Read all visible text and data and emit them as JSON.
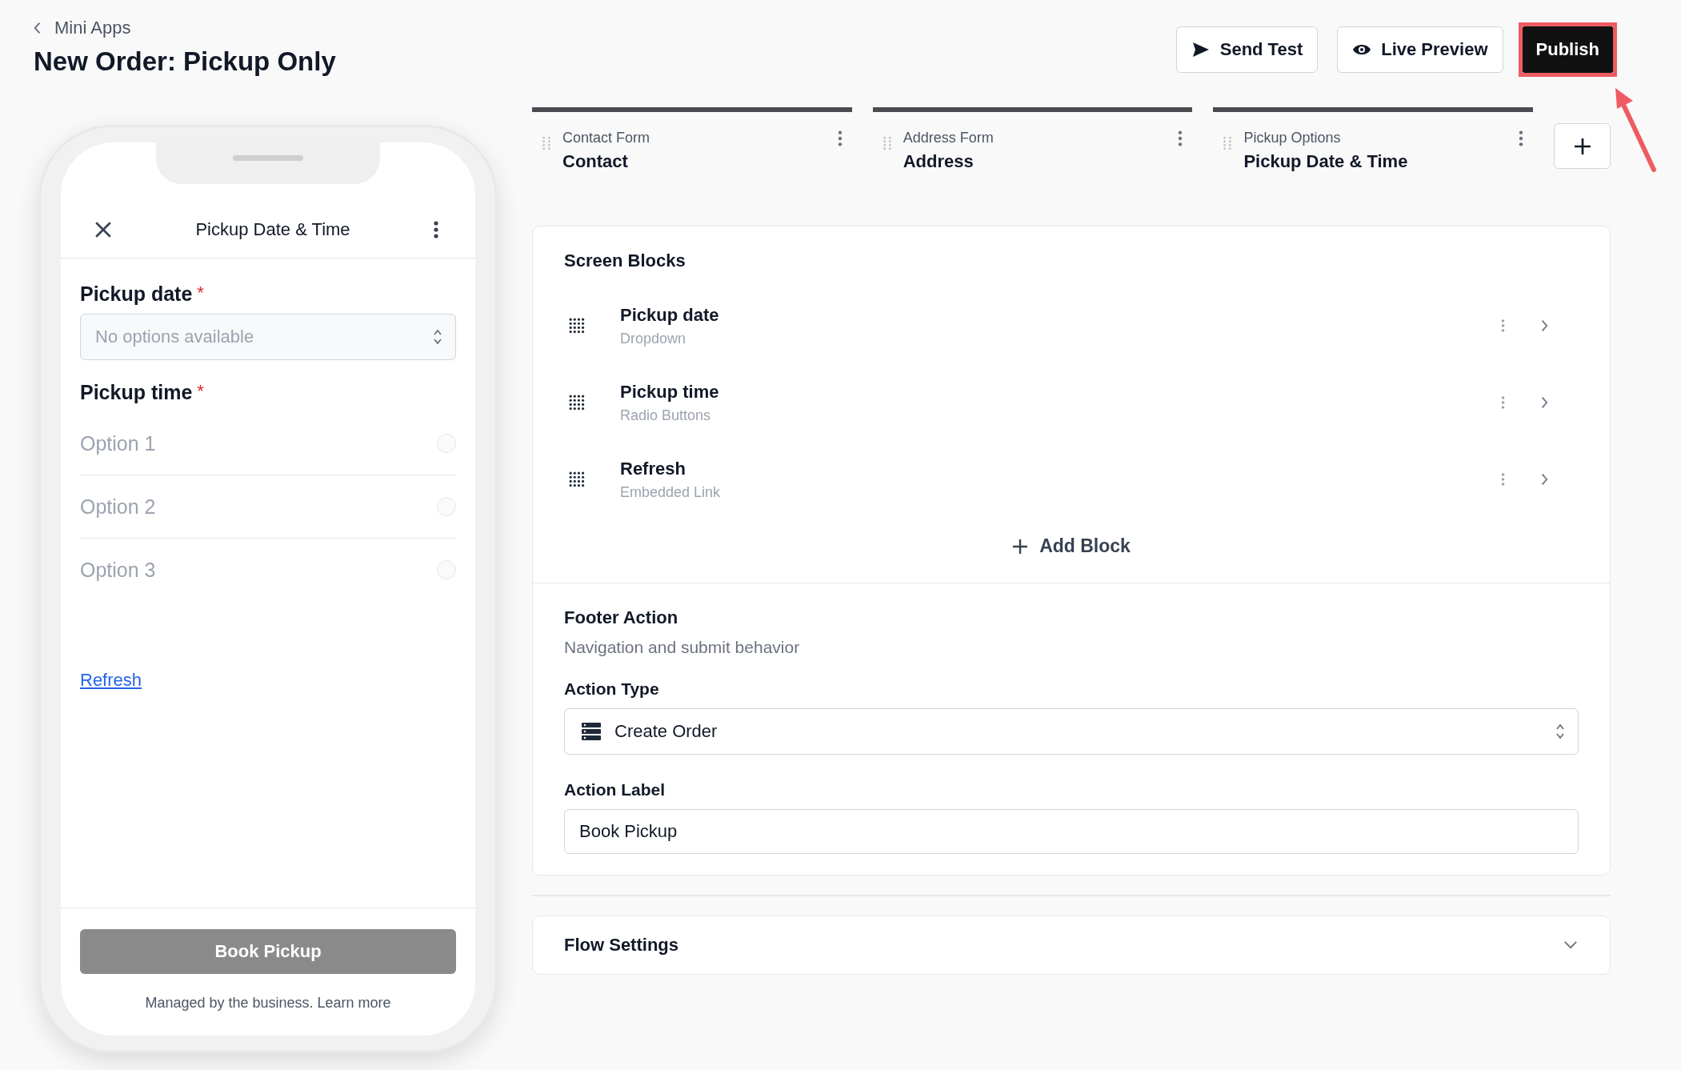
{
  "breadcrumb": {
    "label": "Mini Apps"
  },
  "title": "New Order: Pickup Only",
  "actions": [
    {
      "label": "Send Test",
      "kind": "send",
      "highlighted": false
    },
    {
      "label": "Live Preview",
      "kind": "preview",
      "highlighted": false
    },
    {
      "label": "Publish",
      "kind": "primary",
      "highlighted": true
    }
  ],
  "phone": {
    "header_title": "Pickup Date & Time",
    "required_mark": "*",
    "fields": [
      {
        "label": "Pickup date",
        "required": true,
        "kind": "select",
        "placeholder": "No options available"
      },
      {
        "label": "Pickup time",
        "required": true,
        "kind": "radio",
        "options": [
          {
            "label": "Option 1",
            "selected": false
          },
          {
            "label": "Option 2",
            "selected": false
          },
          {
            "label": "Option 3",
            "selected": false
          }
        ]
      }
    ],
    "link": "Refresh",
    "button": {
      "label": "Book Pickup",
      "disabled": true
    },
    "footer_note": "Managed by the business. Learn more"
  },
  "steps": [
    {
      "caption": "Contact Form",
      "title": "Contact"
    },
    {
      "caption": "Address Form",
      "title": "Address"
    },
    {
      "caption": "Pickup Options",
      "title": "Pickup Date & Time"
    }
  ],
  "screen_blocks": {
    "title": "Screen Blocks",
    "add_label": "Add Block",
    "blocks": [
      {
        "name": "Pickup date",
        "type": "Dropdown"
      },
      {
        "name": "Pickup time",
        "type": "Radio Buttons"
      },
      {
        "name": "Refresh",
        "type": "Embedded Link"
      }
    ]
  },
  "footer_action": {
    "title": "Footer Action",
    "subtitle": "Navigation and submit behavior",
    "action_type_label": "Action Type",
    "action_type": "Create Order",
    "action_label_label": "Action Label",
    "action_label": "Book Pickup"
  },
  "flow_settings": {
    "title": "Flow Settings",
    "expanded": false
  }
}
